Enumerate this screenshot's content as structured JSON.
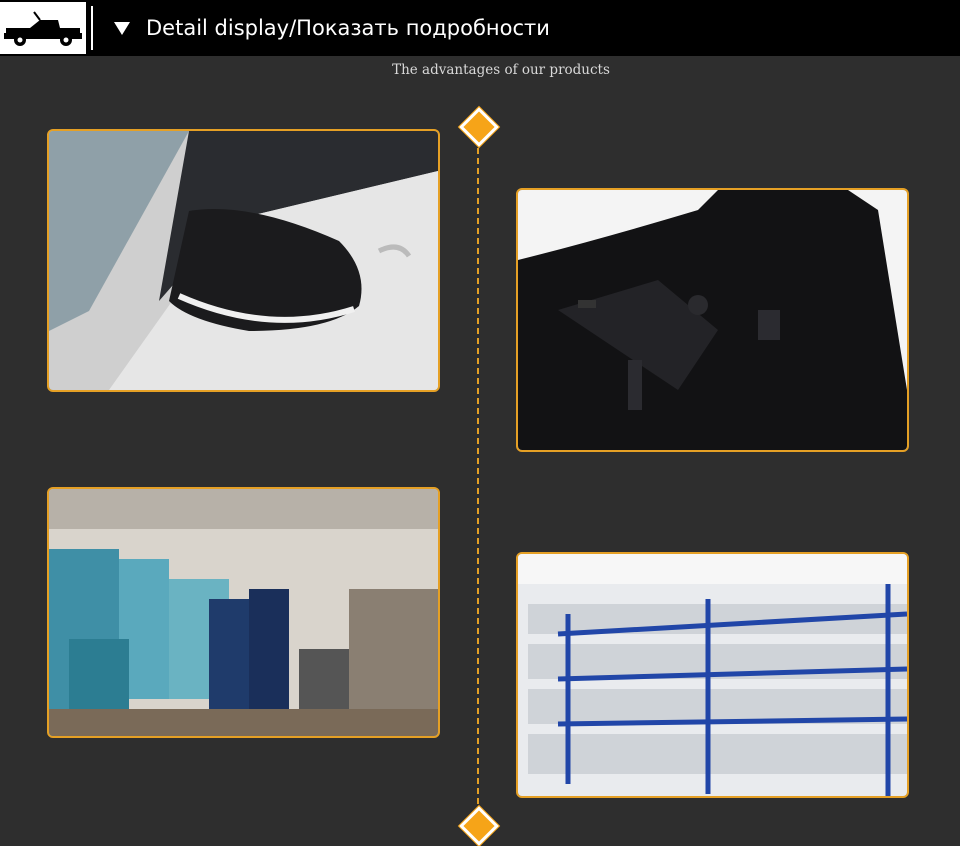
{
  "header": {
    "title": "Detail display/Показать подробности",
    "logo_icon": "car-icon"
  },
  "section": {
    "subtitle": "The advantages of our products"
  },
  "colors": {
    "accent": "#e5a025",
    "background": "#2e2e2e",
    "header_bg": "#000000"
  },
  "images": [
    {
      "name": "mirror-cover-installed-photo"
    },
    {
      "name": "mirror-cover-inside-photo"
    },
    {
      "name": "factory-workshop-photo"
    },
    {
      "name": "warehouse-shelves-photo"
    }
  ]
}
